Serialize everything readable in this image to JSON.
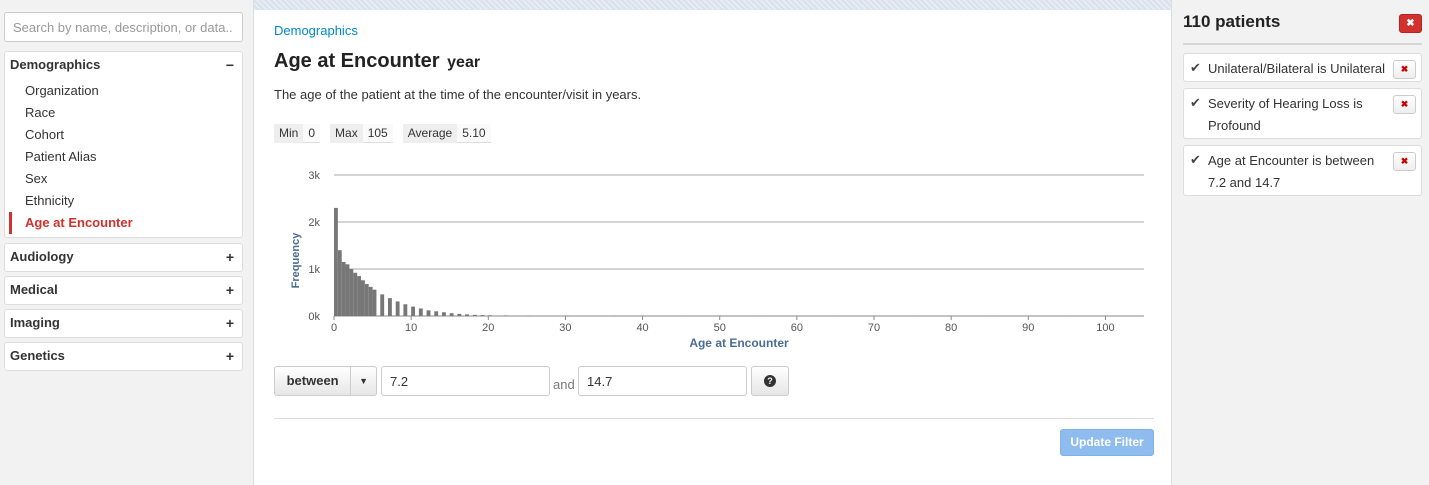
{
  "search": {
    "placeholder": "Search by name, description, or data.."
  },
  "sidebar": {
    "sections": [
      {
        "title": "Demographics",
        "sign": "−",
        "items": [
          "Organization",
          "Race",
          "Cohort",
          "Patient Alias",
          "Sex",
          "Ethnicity",
          "Age at Encounter"
        ],
        "active": "Age at Encounter"
      },
      {
        "title": "Audiology",
        "sign": "+"
      },
      {
        "title": "Medical",
        "sign": "+"
      },
      {
        "title": "Imaging",
        "sign": "+"
      },
      {
        "title": "Genetics",
        "sign": "+"
      }
    ]
  },
  "main": {
    "breadcrumb": "Demographics",
    "title": "Age at Encounter",
    "unit": "year",
    "description": "The age of the patient at the time of the encounter/visit in years.",
    "stats": [
      {
        "label": "Min",
        "value": "0"
      },
      {
        "label": "Max",
        "value": "105"
      },
      {
        "label": "Average",
        "value": "5.10"
      }
    ],
    "operator": "between",
    "value_from": "7.2",
    "and_label": "and",
    "value_to": "14.7",
    "help_icon": "?",
    "update_label": "Update Filter"
  },
  "chart_data": {
    "type": "bar",
    "title": "",
    "xlabel": "Age at Encounter",
    "ylabel": "Frequency",
    "xlim": [
      0,
      105
    ],
    "ylim": [
      0,
      3000
    ],
    "x_ticks": [
      0,
      10,
      20,
      30,
      40,
      50,
      60,
      70,
      80,
      90,
      100
    ],
    "y_ticks": [
      0,
      1000,
      2000,
      3000
    ],
    "y_tick_labels": [
      "0k",
      "1k",
      "2k",
      "3k"
    ],
    "grid": true,
    "bar_color": "#777777",
    "axis_label_color": "#4a6d96",
    "series": [
      {
        "x": [
          0,
          0.5,
          1,
          1.5,
          2,
          2.5,
          3,
          3.5,
          4,
          4.5,
          5,
          6,
          7,
          8,
          9,
          10,
          11,
          12,
          13,
          14,
          15,
          16,
          17,
          18,
          19,
          20,
          22,
          25,
          30,
          36,
          40,
          45,
          50,
          55,
          60,
          65,
          70,
          75,
          80,
          85,
          90,
          95,
          100,
          104
        ],
        "values": [
          2300,
          1400,
          1150,
          1100,
          1000,
          920,
          850,
          760,
          680,
          620,
          560,
          460,
          380,
          310,
          250,
          200,
          160,
          120,
          100,
          80,
          60,
          45,
          35,
          25,
          20,
          15,
          12,
          10,
          8,
          6,
          5,
          5,
          4,
          4,
          4,
          3,
          3,
          3,
          3,
          2,
          2,
          2,
          2,
          2
        ]
      }
    ]
  },
  "right": {
    "count_label": "110 patients",
    "close_icon": "✖",
    "filters": [
      {
        "text": "Unilateral/Bilateral is Unilateral"
      },
      {
        "text": "Severity of Hearing Loss is Profound"
      },
      {
        "text": "Age at Encounter is between 7.2 and 14.7"
      }
    ],
    "check_glyph": "✔",
    "remove_glyph": "✖"
  }
}
